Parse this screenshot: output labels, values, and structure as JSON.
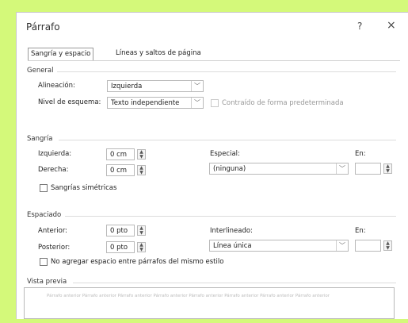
{
  "dialog": {
    "title": "Párrafo",
    "help_label": "?",
    "close_label": "×"
  },
  "tabs": [
    {
      "label": "Sangría y espacio"
    },
    {
      "label": "Líneas y saltos de página"
    }
  ],
  "general": {
    "title": "General",
    "alignment_label": "Alineación:",
    "alignment_value": "Izquierda",
    "outline_label": "Nivel de esquema:",
    "outline_value": "Texto independiente",
    "collapsed_label": "Contraído de forma predeterminada"
  },
  "indent": {
    "title": "Sangría",
    "left_label": "Izquierda:",
    "left_value": "0 cm",
    "right_label": "Derecha:",
    "right_value": "0 cm",
    "special_label": "Especial:",
    "special_value": "(ninguna)",
    "by_label": "En:",
    "by_value": "",
    "mirror_label": "Sangrías simétricas"
  },
  "spacing": {
    "title": "Espaciado",
    "before_label": "Anterior:",
    "before_value": "0 pto",
    "after_label": "Posterior:",
    "after_value": "0 pto",
    "line_label": "Interlineado:",
    "line_value": "Línea única",
    "at_label": "En:",
    "at_value": "",
    "no_space_label": "No agregar espacio entre párrafos del mismo estilo"
  },
  "preview": {
    "title": "Vista previa",
    "sample": "Párrafo anterior Párrafo anterior Párrafo anterior Párrafo anterior Párrafo anterior Párrafo anterior Párrafo anterior Párrafo anterior"
  }
}
